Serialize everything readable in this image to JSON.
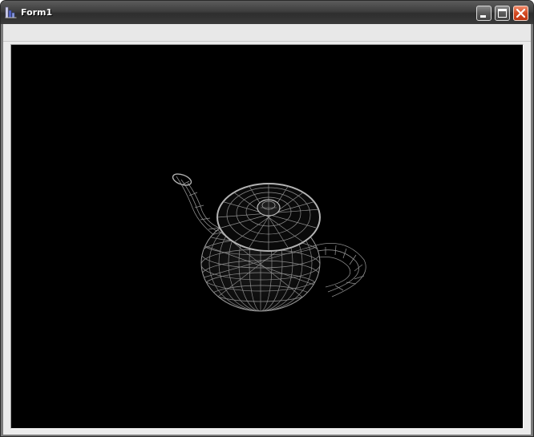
{
  "window": {
    "title": "Form1"
  },
  "titlebar_buttons": {
    "minimize": "minimize-icon",
    "maximize": "maximize-icon",
    "close": "close-icon"
  },
  "viewport": {
    "object": "wireframe-teapot",
    "background": "#000000",
    "wire_color": "#9a9a9a"
  },
  "colors": {
    "titlebar": "#3a3a3a",
    "close_button": "#d34a22",
    "client": "#ebebeb"
  }
}
